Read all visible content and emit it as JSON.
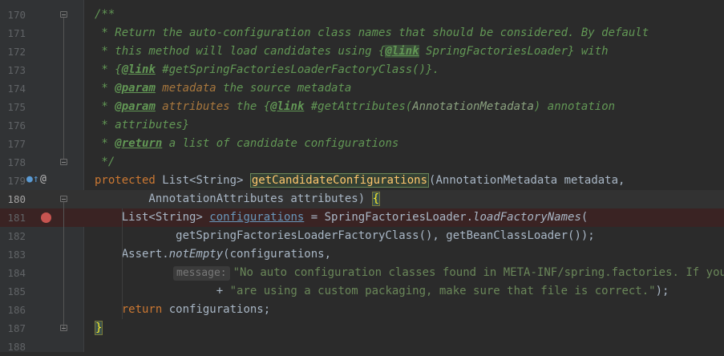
{
  "editor": {
    "lines": [
      {
        "num": "170",
        "text": "/**"
      },
      {
        "num": "171",
        "text": " * Return the auto-configuration class names that should be considered. By default"
      },
      {
        "num": "172",
        "pre": " * this method will load candidates using {",
        "tag": "@link",
        "post": " SpringFactoriesLoader} with"
      },
      {
        "num": "173",
        "pre": " * {",
        "tag": "@link",
        "post": " #getSpringFactoriesLoaderFactoryClass()}."
      },
      {
        "num": "174",
        "pre": " * ",
        "tag": "@param",
        "post1": " metadata",
        "post2": " the source metadata"
      },
      {
        "num": "175",
        "pre": " * ",
        "tag": "@param",
        "post1": " attributes",
        "post2": " the {",
        "tag2": "@link",
        "post3": " #getAttributes(",
        "ref": "AnnotationMetadata",
        "post4": ") annotation"
      },
      {
        "num": "176",
        "text": " * attributes}"
      },
      {
        "num": "177",
        "pre": " * ",
        "tag": "@return",
        "post": " a list of candidate configurations"
      },
      {
        "num": "178",
        "text": " */"
      },
      {
        "num": "179",
        "kw": "protected",
        "a": " List<String> ",
        "fn": "getCandidateConfigurations",
        "b": "(AnnotationMetadata metadata,"
      },
      {
        "num": "180",
        "a": "        AnnotationAttributes attributes) ",
        "brace": "{"
      },
      {
        "num": "181",
        "a": "    List<String> ",
        "field": "configurations",
        "b": " = SpringFactoriesLoader.",
        "it": "loadFactoryNames",
        "c": "("
      },
      {
        "num": "182",
        "text": "            getSpringFactoriesLoaderFactoryClass(), getBeanClassLoader());"
      },
      {
        "num": "183",
        "a": "    Assert.",
        "it": "notEmpty",
        "b": "(configurations,"
      },
      {
        "num": "184",
        "hint": "message:",
        "str": "\"No auto configuration classes found in META-INF/spring.factories. If you \""
      },
      {
        "num": "185",
        "a": "                  + ",
        "str": "\"are using a custom packaging, make sure that file is correct.\"",
        "b": ");"
      },
      {
        "num": "186",
        "kw": "    return",
        "a": " configurations;"
      },
      {
        "num": "187",
        "brace": "}"
      },
      {
        "num": "188",
        "text": ""
      }
    ]
  },
  "icons": {
    "implements": "implements-icon",
    "annotation": "at-icon",
    "breakpoint": "breakpoint-icon"
  },
  "colors": {
    "background": "#2b2b2b",
    "keyword": "#cc7832",
    "method": "#ffc66d",
    "comment": "#629755",
    "string": "#6a8759",
    "breakpoint": "#c75450"
  }
}
